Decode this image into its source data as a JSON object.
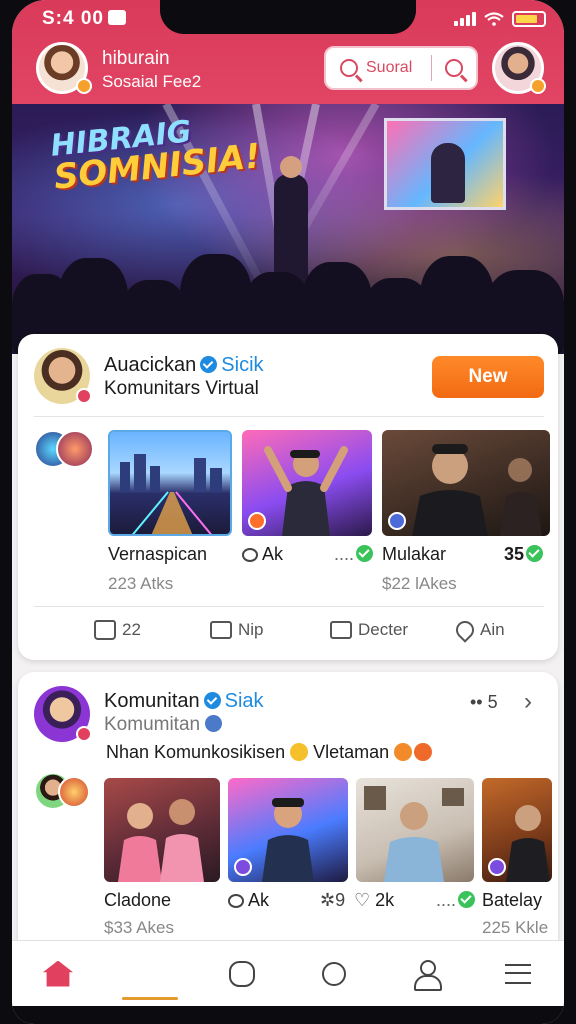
{
  "status_bar": {
    "time": "S:4 00",
    "battery": "battery-icon",
    "wifi": "wifi-icon",
    "signal": "signal-icon"
  },
  "header": {
    "title": "hiburain",
    "subtitle": "Sosaial Fee2",
    "search": {
      "placeholder": "Suoral"
    }
  },
  "hero": {
    "headline_1": "HIBRAIG",
    "headline_2": "SOMNISIA!"
  },
  "post1": {
    "author": "Auacickan",
    "badge_label": "Sicik",
    "community": "Komunitars  Virtual",
    "new_button": "New",
    "items": [
      {
        "title": "Vernaspican",
        "meta": "223 Atks"
      },
      {
        "title": "Ak",
        "meta": ""
      },
      {
        "title": "Mulakar",
        "meta": "$22 lAkes",
        "count": "35"
      }
    ],
    "actions": [
      {
        "label": "22",
        "icon": "thumbs-up-icon"
      },
      {
        "label": "Nip",
        "icon": "comment-icon"
      },
      {
        "label": "Decter",
        "icon": "message-icon"
      },
      {
        "label": "Ain",
        "icon": "share-icon"
      }
    ]
  },
  "post2": {
    "author": "Komunitan",
    "badge_label": "Siak",
    "sub": "Komumitan",
    "more": "•• 5",
    "caption_1": "Nhan Komunkosikisen",
    "caption_2": "Vletaman",
    "items": [
      {
        "title": "Cladone",
        "meta": "$33 Akes"
      },
      {
        "title": "Ak",
        "meta": ""
      },
      {
        "title": "9",
        "meta": ""
      },
      {
        "title": "2k",
        "meta": ""
      },
      {
        "title": "Batelay",
        "meta": "225 Kkle"
      }
    ]
  },
  "bottom_nav": [
    "home-icon",
    "search-icon",
    "chat-icon",
    "comment-icon",
    "profile-icon",
    "menu-icon"
  ],
  "colors": {
    "brand": "#e2405f",
    "accent_orange": "#f26a12",
    "verified": "#1f8be0",
    "check": "#3ac35a"
  }
}
